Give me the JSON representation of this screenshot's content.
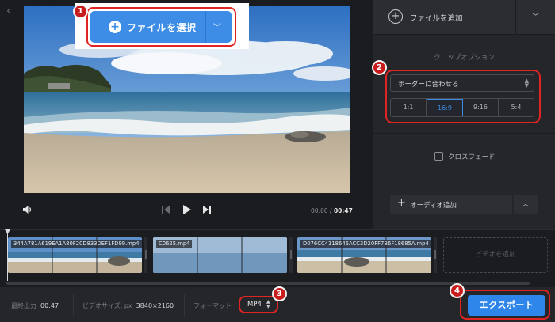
{
  "player": {
    "select_file_label": "ファイルを選択",
    "time_current": "00:00",
    "time_separator": "/",
    "time_total": "00:47"
  },
  "right_panel": {
    "add_file_label": "ファイルを追加",
    "crop_title": "クロップオプション",
    "fit_select_value": "ボーダーに合わせる",
    "ratios": [
      "1:1",
      "16:9",
      "9:16",
      "5:4"
    ],
    "active_ratio": "16:9",
    "crossfade_label": "クロスフェード",
    "crossfade_checked": false,
    "audio_add_label": "オーディオ追加"
  },
  "timeline": {
    "clips": [
      {
        "name": "344A781A619EA1A80F20D833DEF1FD99.mp4"
      },
      {
        "name": "C0625.mp4"
      },
      {
        "name": "D076CC4118646ACC3D20FF7B6F18685A.mp4"
      }
    ],
    "add_video_label": "ビデオを追加"
  },
  "bottom": {
    "final_output_label": "最終出力",
    "final_output_value": "00:47",
    "video_size_label": "ビデオサイズ, px",
    "video_size_value": "3840×2160",
    "format_label": "フォーマット",
    "format_value": "MP4",
    "export_label": "エクスポート"
  },
  "annotations": {
    "badges": [
      "1",
      "2",
      "3",
      "4"
    ],
    "outline_color": "#e02424"
  },
  "colors": {
    "accent": "#3d8ce6",
    "export_button": "#2f86ea",
    "background": "#1b1c20",
    "panel": "#252629"
  }
}
